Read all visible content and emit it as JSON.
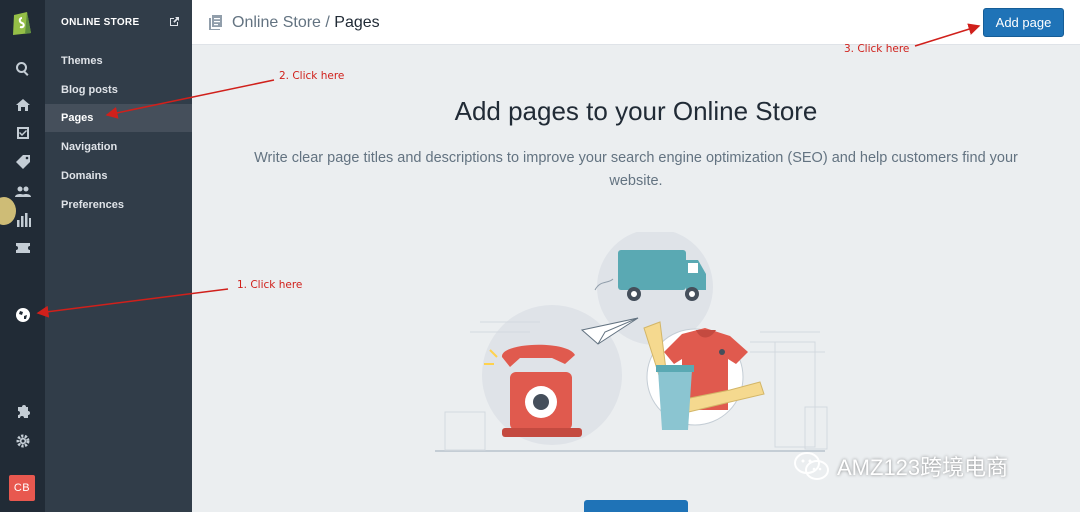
{
  "rail": {
    "avatar_initials": "CB",
    "icons": [
      "search-icon",
      "home-icon",
      "orders-icon",
      "products-icon",
      "customers-icon",
      "analytics-icon",
      "discounts-icon",
      "online-store-icon",
      "apps-icon",
      "settings-icon"
    ]
  },
  "sidebar": {
    "header": "ONLINE STORE",
    "items": [
      {
        "label": "Themes"
      },
      {
        "label": "Blog posts"
      },
      {
        "label": "Pages"
      },
      {
        "label": "Navigation"
      },
      {
        "label": "Domains"
      },
      {
        "label": "Preferences"
      }
    ],
    "active": "Pages"
  },
  "topbar": {
    "breadcrumb_parent": "Online Store",
    "separator": "/",
    "breadcrumb_current": "Pages",
    "add_button_label": "Add page"
  },
  "main": {
    "title": "Add pages to your Online Store",
    "description": "Write clear page titles and descriptions to improve your search engine optimization (SEO) and help customers find your website."
  },
  "annotations": {
    "step1": "1. Click here",
    "step2": "2. Click here",
    "step3": "3. Click here",
    "color": "#d0201b"
  },
  "watermark": {
    "text": "AMZ123跨境电商"
  },
  "colors": {
    "rail": "#212b36",
    "sidebar": "#313d49",
    "accent": "#1f73b7",
    "background": "#ebeef0"
  }
}
